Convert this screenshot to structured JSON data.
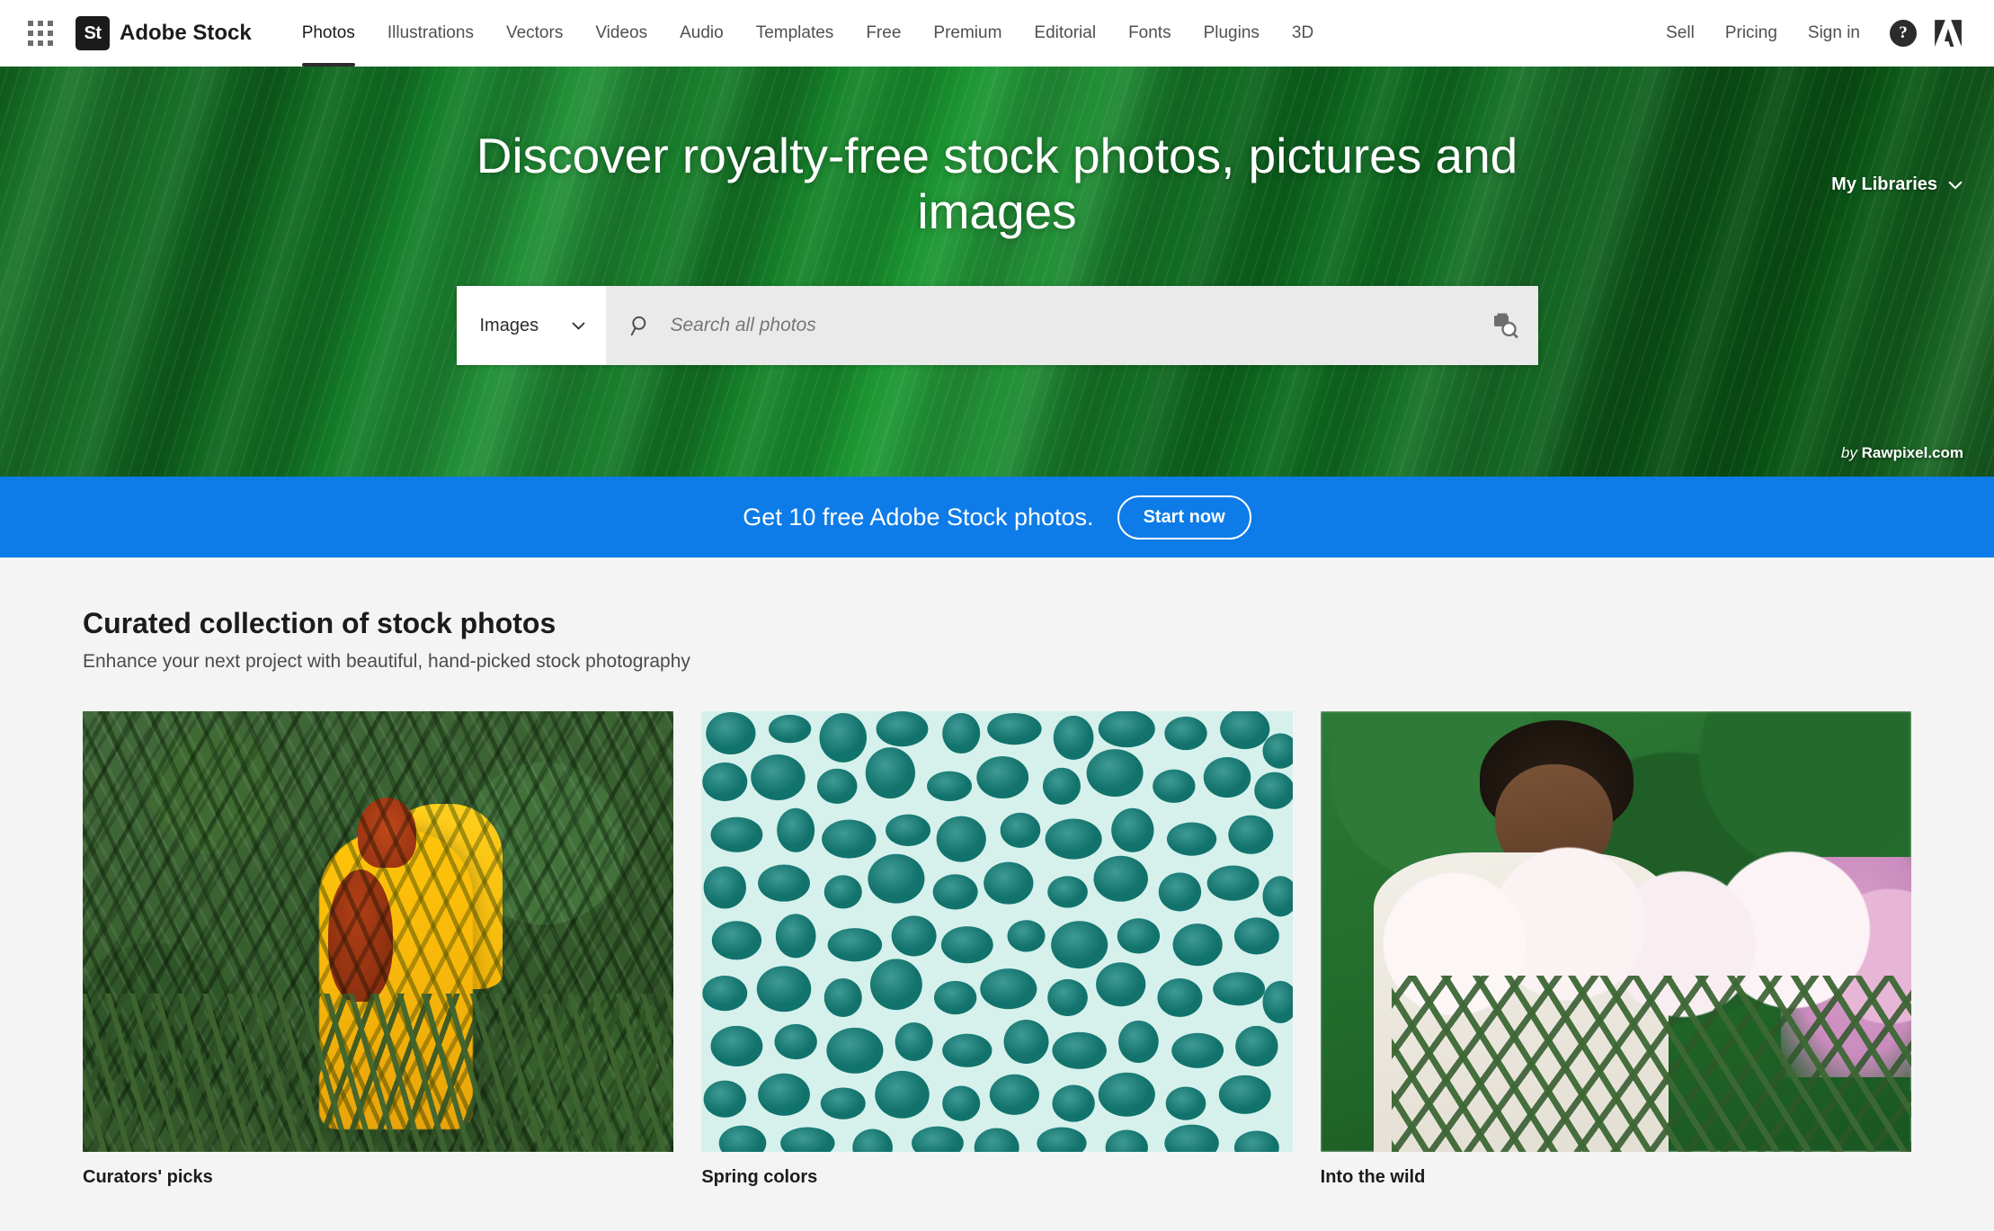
{
  "header": {
    "app_grid_icon": "app-grid-icon",
    "brand_mark": "St",
    "brand_name": "Adobe Stock",
    "nav": [
      {
        "label": "Photos",
        "active": true
      },
      {
        "label": "Illustrations",
        "active": false
      },
      {
        "label": "Vectors",
        "active": false
      },
      {
        "label": "Videos",
        "active": false
      },
      {
        "label": "Audio",
        "active": false
      },
      {
        "label": "Templates",
        "active": false
      },
      {
        "label": "Free",
        "active": false
      },
      {
        "label": "Premium",
        "active": false
      },
      {
        "label": "Editorial",
        "active": false
      },
      {
        "label": "Fonts",
        "active": false
      },
      {
        "label": "Plugins",
        "active": false
      },
      {
        "label": "3D",
        "active": false
      }
    ],
    "right_links": [
      {
        "label": "Sell"
      },
      {
        "label": "Pricing"
      },
      {
        "label": "Sign in"
      }
    ],
    "help_icon": "help-question-icon",
    "help_glyph": "?",
    "adobe_logo_icon": "adobe-logo-icon"
  },
  "hero": {
    "title": "Discover royalty-free stock photos, pictures and images",
    "my_libraries": "My Libraries",
    "my_libraries_chevron_icon": "chevron-down-icon",
    "credit_prefix": "by",
    "credit_name": "Rawpixel.com",
    "search": {
      "type_value": "Images",
      "type_chevron_icon": "chevron-down-icon",
      "search_icon": "search-icon",
      "placeholder": "Search all photos",
      "value": "",
      "visual_search_icon": "visual-search-icon"
    }
  },
  "promo": {
    "text": "Get 10 free Adobe Stock photos.",
    "button_label": "Start now",
    "background_color": "#0e7ce8"
  },
  "main": {
    "section_title": "Curated collection of stock photos",
    "section_subtitle": "Enhance your next project with beautiful, hand-picked stock photography",
    "cards": [
      {
        "label": "Curators' picks",
        "image_alt": "Two red-haired people in yellow raincoats embracing among green ferns"
      },
      {
        "label": "Spring colors",
        "image_alt": "Teal organic cell-like pebble pattern on pale mint background"
      },
      {
        "label": "Into the wild",
        "image_alt": "Woman in white shirt behind white and pink rhododendron blossoms"
      }
    ]
  },
  "colors": {
    "promo_blue": "#0e7ce8",
    "page_background": "#f4f4f4",
    "header_background": "#ffffff",
    "text_primary": "#1b1b1b",
    "text_secondary": "#505050"
  }
}
